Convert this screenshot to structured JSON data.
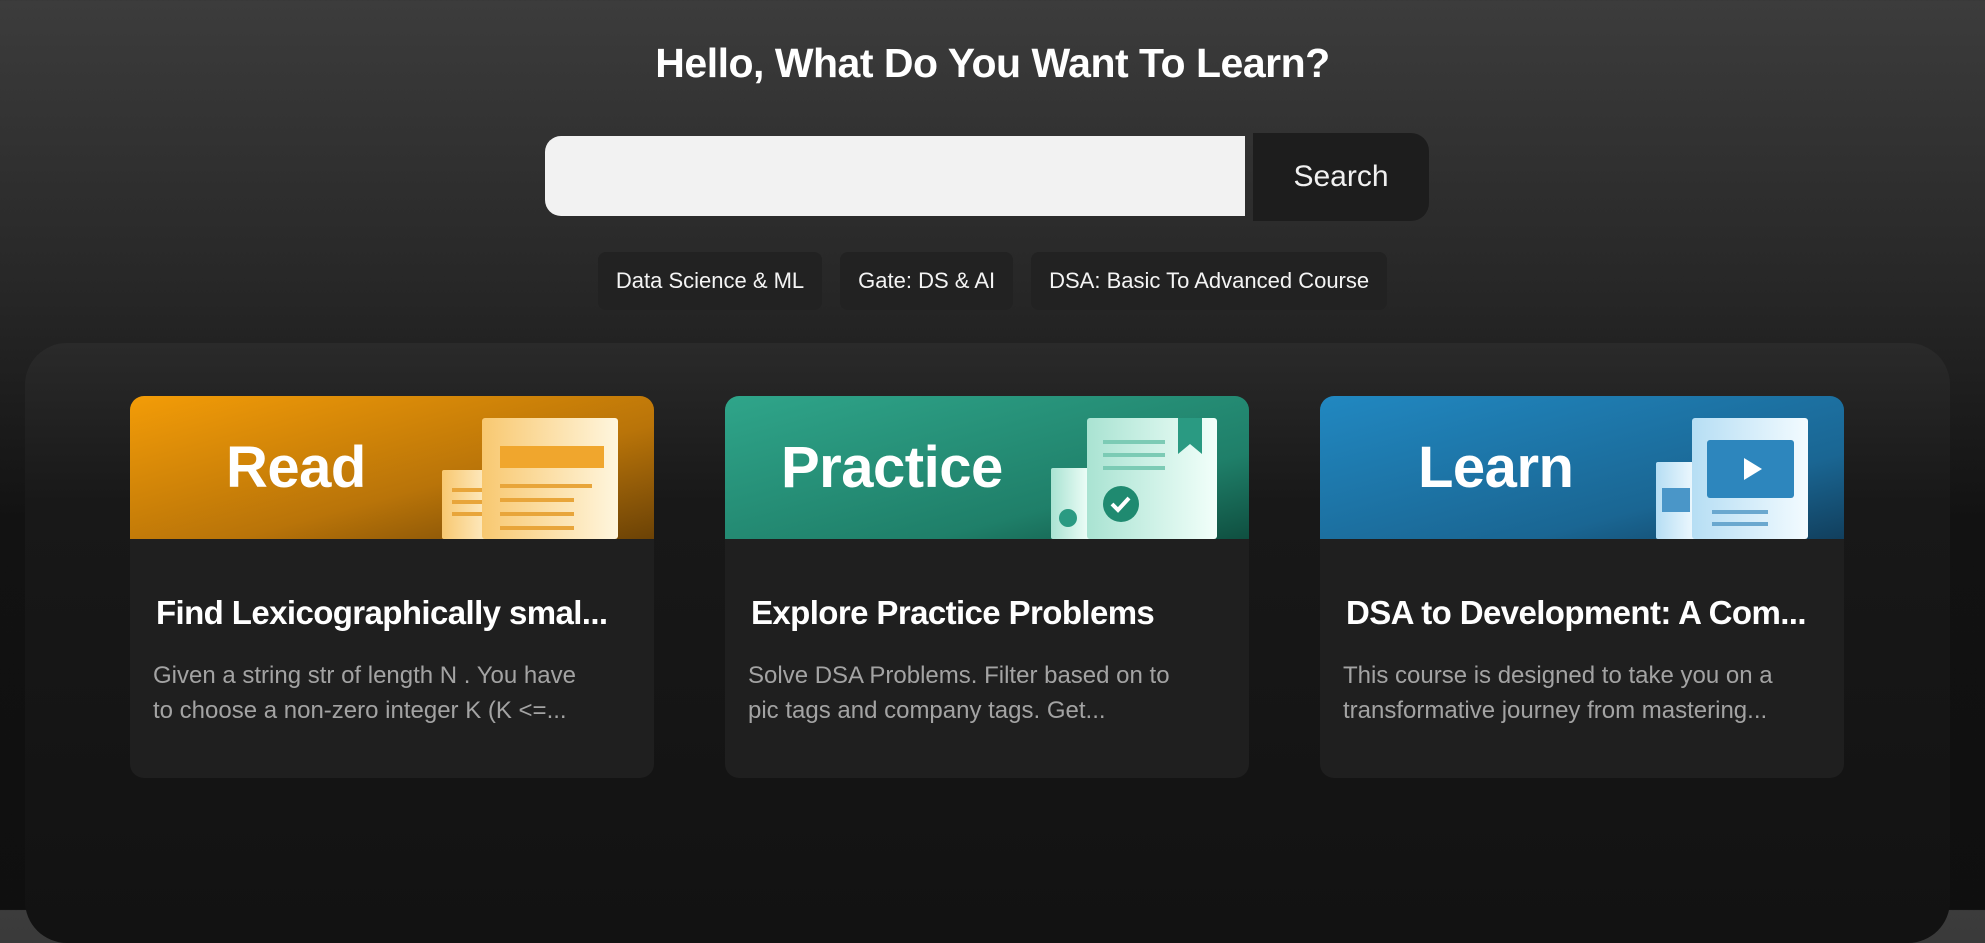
{
  "headline": "Hello, What Do You Want To Learn?",
  "search": {
    "placeholder": "",
    "value": "",
    "button_label": "Search"
  },
  "chips": [
    "Data Science & ML",
    "Gate: DS & AI",
    "DSA: Basic To Advanced Course"
  ],
  "cards": [
    {
      "banner_word": "Read",
      "title": "Find Lexicographically smal...",
      "desc_line1": "Given a string str of length N . You have",
      "desc_line2": "to choose a non-zero integer K (K <=..."
    },
    {
      "banner_word": "Practice",
      "title": "Explore Practice Problems",
      "desc_line1": "Solve DSA Problems. Filter based on to",
      "desc_line2": "pic tags and company tags. Get..."
    },
    {
      "banner_word": "Learn",
      "title": "DSA to Development: A Com...",
      "desc_line1": "This course is designed to take you on a",
      "desc_line2": "transformative journey from mastering..."
    }
  ],
  "icons": {
    "read": "document-icon",
    "practice": "checklist-document-icon",
    "learn": "video-document-icon"
  },
  "colors": {
    "read_banner": "#e99a0c",
    "practice_banner": "#2a9a82",
    "learn_banner": "#1e7fb5",
    "button_bg": "#1d1d1d",
    "input_bg": "#f2f2f2"
  }
}
